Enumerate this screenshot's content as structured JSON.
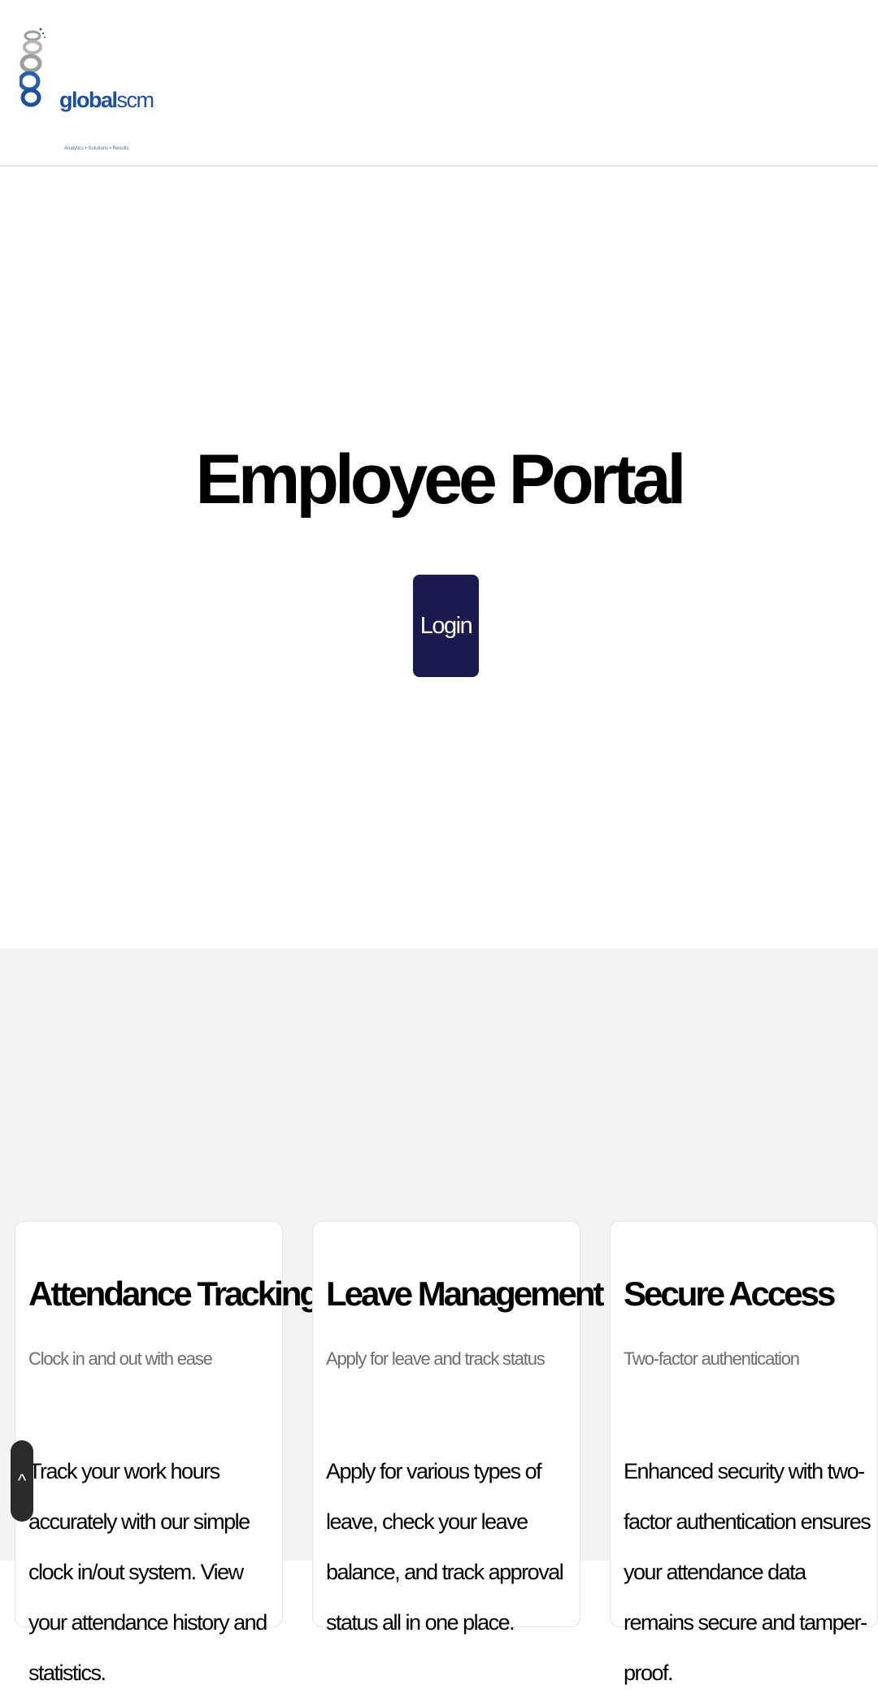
{
  "header": {
    "logo": {
      "text_bold": "global",
      "text_light": "scm",
      "tagline": "Analytics • Solutions • Results"
    }
  },
  "hero": {
    "title": "Employee Portal",
    "login_label": "Login",
    "login_color": "#1b1a4f"
  },
  "features": {
    "cards": [
      {
        "title": "Attendance Tracking",
        "subtitle": "Clock in and out with ease",
        "body": "Track your work hours accurately with our simple clock in/out system. View your attendance history and statistics."
      },
      {
        "title": "Leave Management",
        "subtitle": "Apply for leave and track status",
        "body": "Apply for various types of leave, check your leave balance, and track approval status all in one place."
      },
      {
        "title": "Secure Access",
        "subtitle": "Two-factor authentication",
        "body": "Enhanced security with two-factor authentication ensures your attendance data remains secure and tamper-proof."
      }
    ]
  },
  "scroll_top": {
    "icon": "caret-up-icon",
    "glyph": "^"
  }
}
